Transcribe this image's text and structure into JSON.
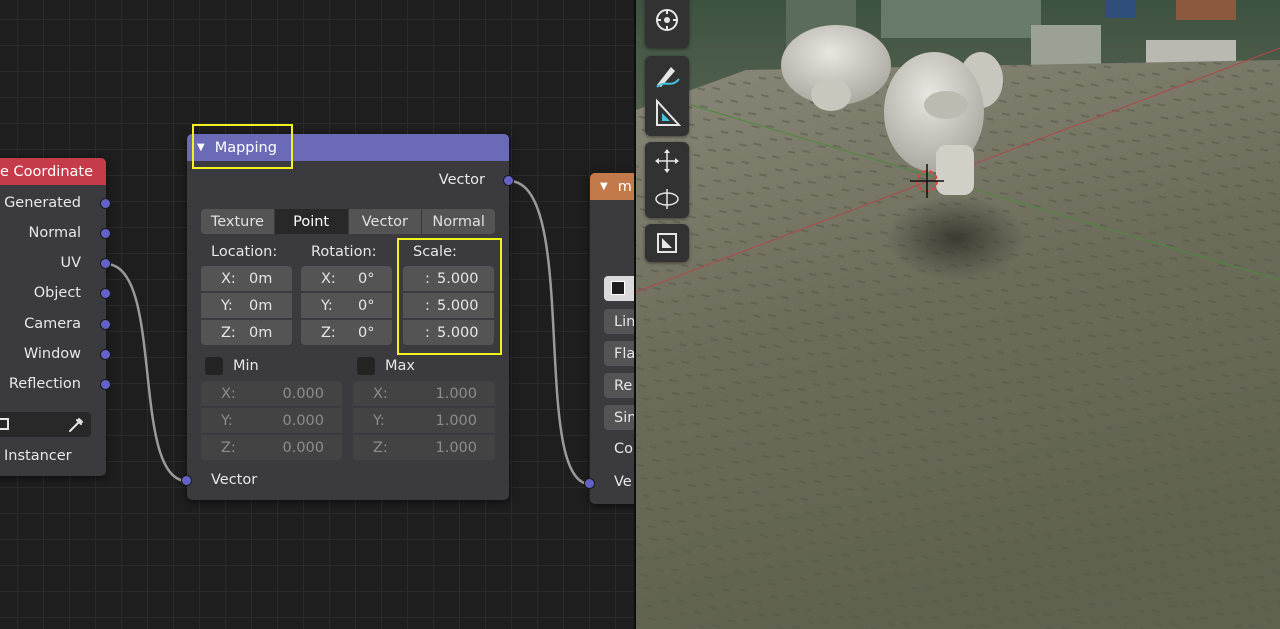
{
  "texcoord_node": {
    "title": "e Coordinate",
    "outputs": [
      "Generated",
      "Normal",
      "UV",
      "Object",
      "Camera",
      "Window",
      "Reflection"
    ],
    "instancer_label": "Instancer"
  },
  "mapping_node": {
    "title": "Mapping",
    "output_vector": "Vector",
    "input_vector": "Vector",
    "types": [
      "Texture",
      "Point",
      "Vector",
      "Normal"
    ],
    "active_type": "Point",
    "location": {
      "label": "Location:",
      "x": "0m",
      "y": "0m",
      "z": "0m"
    },
    "rotation": {
      "label": "Rotation:",
      "x": "0°",
      "y": "0°",
      "z": "0°"
    },
    "scale": {
      "label": "Scale:",
      "x": "5.000",
      "y": "5.000",
      "z": "5.000"
    },
    "axis_labels": [
      "X:",
      "Y:",
      "Z:"
    ],
    "scale_prefix": ":",
    "min": {
      "label": "Min",
      "x": "0.000",
      "y": "0.000",
      "z": "0.000"
    },
    "max": {
      "label": "Max",
      "x": "1.000",
      "y": "1.000",
      "z": "1.000"
    }
  },
  "image_node": {
    "title_fragment": "m",
    "options": [
      "Lin",
      "Fla",
      "Re",
      "Sin"
    ],
    "color_label": "Co",
    "vector_label": "Ve"
  },
  "viewport_tools": [
    "move-view-icon",
    "annotate-icon",
    "measure-icon",
    "transform-icon",
    "orbit-icon",
    "scale-cage-icon"
  ],
  "colors": {
    "texcoord_header": "#c63b4a",
    "mapping_header": "#6a6ab7",
    "image_header": "#c27a4a",
    "socket_vector": "#6363c7",
    "highlight": "#f2f21f"
  }
}
